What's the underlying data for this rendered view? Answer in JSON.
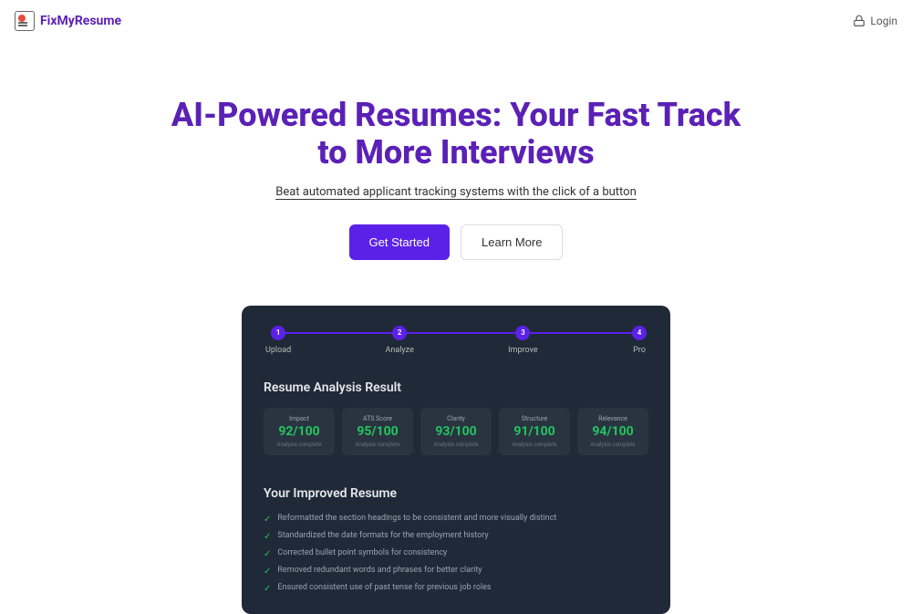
{
  "header": {
    "logo_text": "FixMyResume",
    "login_label": "Login"
  },
  "hero": {
    "title": "AI-Powered Resumes: Your Fast Track to More Interviews",
    "subtitle": "Beat automated applicant tracking systems with the click of a button",
    "get_started_label": "Get Started",
    "learn_more_label": "Learn More"
  },
  "preview": {
    "steps": [
      {
        "num": "1",
        "label": "Upload"
      },
      {
        "num": "2",
        "label": "Analyze"
      },
      {
        "num": "3",
        "label": "Improve"
      },
      {
        "num": "4",
        "label": "Pro"
      }
    ],
    "analysis_title": "Resume Analysis Result",
    "metrics": [
      {
        "label": "Impact",
        "value": "92/100",
        "sub": "Analysis complete"
      },
      {
        "label": "ATS Score",
        "value": "95/100",
        "sub": "Analysis complete"
      },
      {
        "label": "Clarity",
        "value": "93/100",
        "sub": "Analysis complete"
      },
      {
        "label": "Structure",
        "value": "91/100",
        "sub": "Analysis complete"
      },
      {
        "label": "Relevance",
        "value": "94/100",
        "sub": "Analysis complete"
      }
    ],
    "improved_title": "Your Improved Resume",
    "improvements": [
      "Reformatted the section headings to be consistent and more visually distinct",
      "Standardized the date formats for the employment history",
      "Corrected bullet point symbols for consistency",
      "Removed redundant words and phrases for better clarity",
      "Ensured consistent use of past tense for previous job roles"
    ]
  }
}
